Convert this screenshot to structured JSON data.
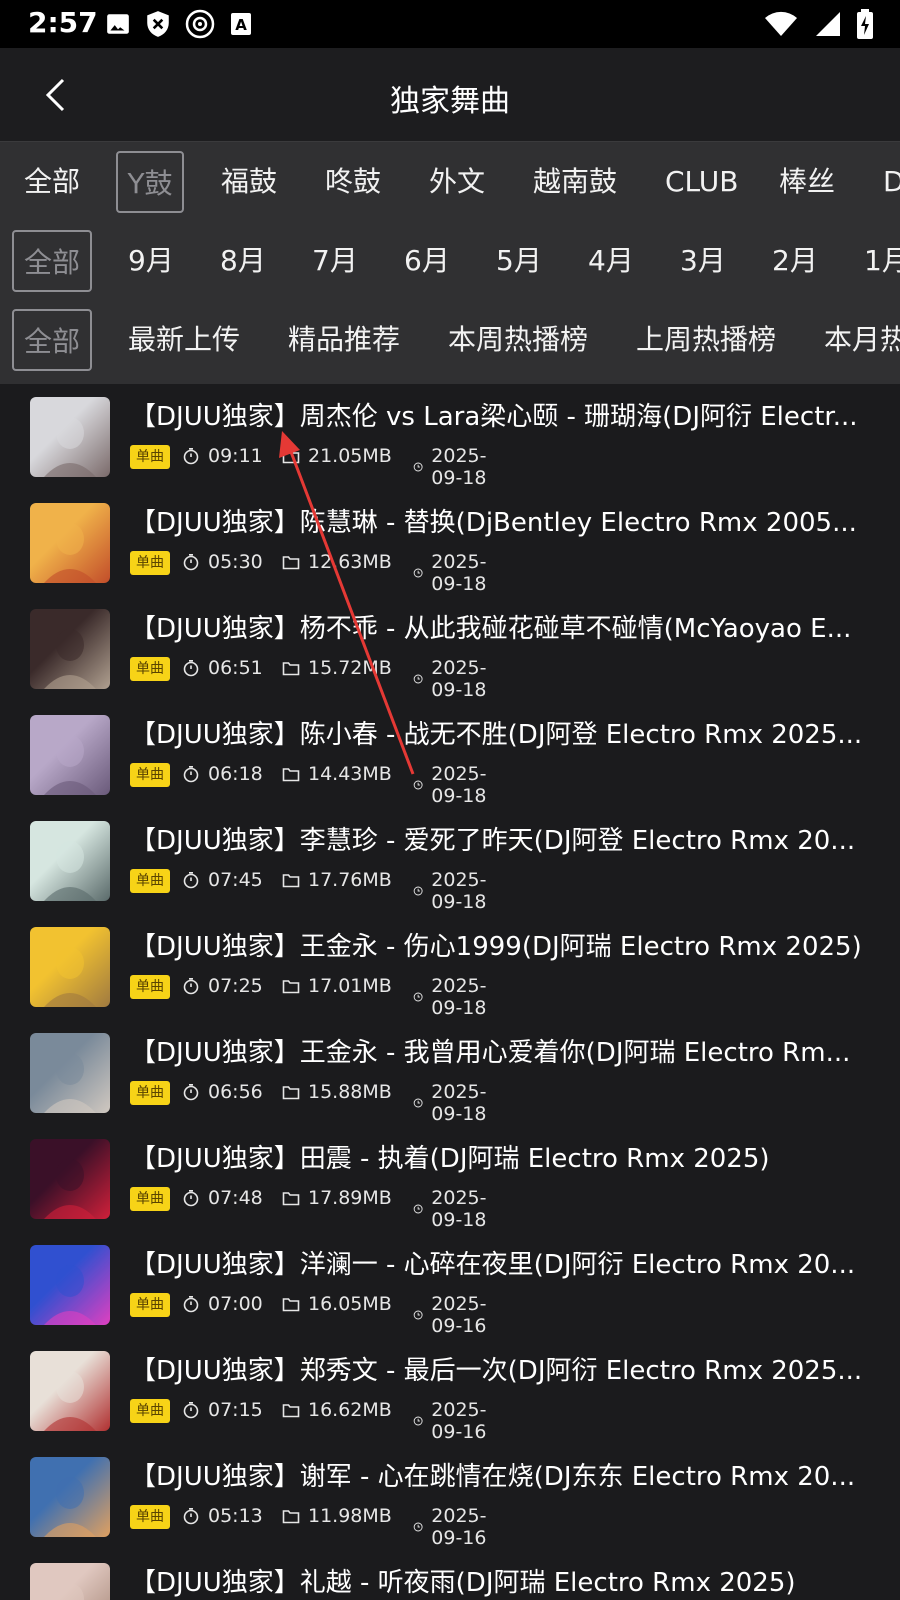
{
  "status_bar": {
    "time": "2:57",
    "left_icons": [
      "image-icon",
      "shield-x-icon",
      "disc-icon",
      "a-box-icon"
    ],
    "right_icons": [
      "wifi-icon",
      "signal-icon",
      "battery-charging-icon"
    ]
  },
  "header": {
    "title": "独家舞曲",
    "back_icon": "chevron-left-icon"
  },
  "filters": {
    "style": [
      "全部",
      "Y鼓",
      "福鼓",
      "咚鼓",
      "外文",
      "越南鼓",
      "CLUB",
      "棒丝",
      "D"
    ],
    "style_selected": 1,
    "month": [
      "全部",
      "9月",
      "8月",
      "7月",
      "6月",
      "5月",
      "4月",
      "3月",
      "2月",
      "1月"
    ],
    "month_selected": 0,
    "ranking": [
      "全部",
      "最新上传",
      "精品推荐",
      "本周热播榜",
      "上周热播榜",
      "本月热"
    ],
    "ranking_selected": 0
  },
  "colors": {
    "tag_bg": "#f7d317",
    "background": "#1b1b1d",
    "filter_bg": "#303032"
  },
  "songs": [
    {
      "title": "【DJUU独家】周杰伦 vs Lara梁心颐 - 珊瑚海(DJ阿衍 Electr...",
      "tag": "单曲",
      "duration": "09:11",
      "size": "21.05MB",
      "date": "2025-09-18"
    },
    {
      "title": "【DJUU独家】陈慧琳 - 替换(DjBentley Electro Rmx 2005...",
      "tag": "单曲",
      "duration": "05:30",
      "size": "12.63MB",
      "date": "2025-09-18"
    },
    {
      "title": "【DJUU独家】杨不乖 - 从此我碰花碰草不碰情(McYaoyao E...",
      "tag": "单曲",
      "duration": "06:51",
      "size": "15.72MB",
      "date": "2025-09-18"
    },
    {
      "title": "【DJUU独家】陈小春 - 战无不胜(DJ阿登 Electro Rmx 2025...",
      "tag": "单曲",
      "duration": "06:18",
      "size": "14.43MB",
      "date": "2025-09-18"
    },
    {
      "title": "【DJUU独家】李慧珍 - 爱死了昨天(DJ阿登 Electro Rmx 20...",
      "tag": "单曲",
      "duration": "07:45",
      "size": "17.76MB",
      "date": "2025-09-18"
    },
    {
      "title": "【DJUU独家】王金永 - 伤心1999(DJ阿瑞 Electro Rmx 2025)",
      "tag": "单曲",
      "duration": "07:25",
      "size": "17.01MB",
      "date": "2025-09-18"
    },
    {
      "title": "【DJUU独家】王金永 - 我曾用心爱着你(DJ阿瑞 Electro Rm...",
      "tag": "单曲",
      "duration": "06:56",
      "size": "15.88MB",
      "date": "2025-09-18"
    },
    {
      "title": "【DJUU独家】田震 - 执着(DJ阿瑞 Electro Rmx 2025)",
      "tag": "单曲",
      "duration": "07:48",
      "size": "17.89MB",
      "date": "2025-09-18"
    },
    {
      "title": "【DJUU独家】洋澜一 - 心碎在夜里(DJ阿衍 Electro Rmx 20...",
      "tag": "单曲",
      "duration": "07:00",
      "size": "16.05MB",
      "date": "2025-09-16"
    },
    {
      "title": "【DJUU独家】郑秀文 - 最后一次(DJ阿衍 Electro Rmx 2025...",
      "tag": "单曲",
      "duration": "07:15",
      "size": "16.62MB",
      "date": "2025-09-16"
    },
    {
      "title": "【DJUU独家】谢军 - 心在跳情在烧(DJ东东 Electro Rmx 20...",
      "tag": "单曲",
      "duration": "05:13",
      "size": "11.98MB",
      "date": "2025-09-16"
    },
    {
      "title": "【DJUU独家】礼越 - 听夜雨(DJ阿瑞 Electro Rmx 2025)",
      "tag": "",
      "duration": "",
      "size": "",
      "date": ""
    }
  ]
}
